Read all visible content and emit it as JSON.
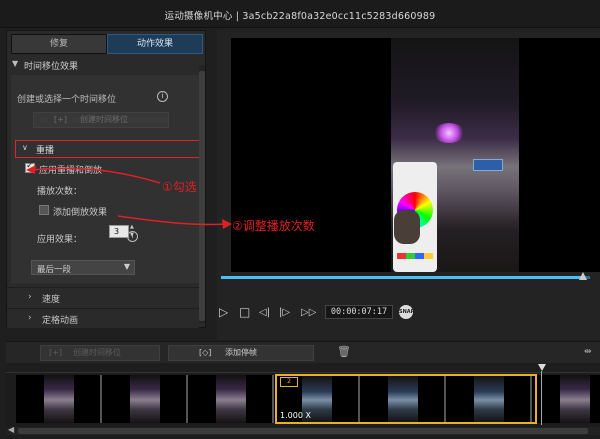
{
  "window": {
    "title": "运动摄像机中心  |  3a5cb22a8f0a32e0cc11c5283d660989"
  },
  "tabs": [
    {
      "label": "修复",
      "active": false
    },
    {
      "label": "动作效果",
      "active": true
    }
  ],
  "time_shift": {
    "section_label": "时间移位效果",
    "create_label": "创建或选择一个时间移位",
    "create_button": "创建时间移位",
    "replay": {
      "label": "重播",
      "apply_checkbox": {
        "label": "应用重播和倒放",
        "checked": true
      },
      "play_count_label": "播放次数：",
      "play_count_value": "3",
      "add_reverse_checkbox": {
        "label": "添加倒放效果",
        "checked": false
      },
      "apply_effect_label": "应用效果：",
      "apply_effect_value": "最后一段"
    },
    "speed_section": "速度",
    "freeze_section": "定格动画"
  },
  "player": {
    "timecode": "00:00:07:17",
    "progress_fraction": 0.98,
    "snapshot_label": "SNAP"
  },
  "bottom_toolbar": {
    "create_time_shift": "创建时间移位",
    "add_freeze": "添加停帧"
  },
  "timeline": {
    "selected_rate": "1.000 X",
    "speed_badge": "2"
  },
  "annotations": {
    "check": "①勾选",
    "adjust": "②调整播放次数"
  },
  "colors": {
    "accent_blue": "#48c0f5",
    "active_tab": "#1e3b57",
    "annotation_red": "#e11f26",
    "selection_gold": "#e7b224"
  }
}
